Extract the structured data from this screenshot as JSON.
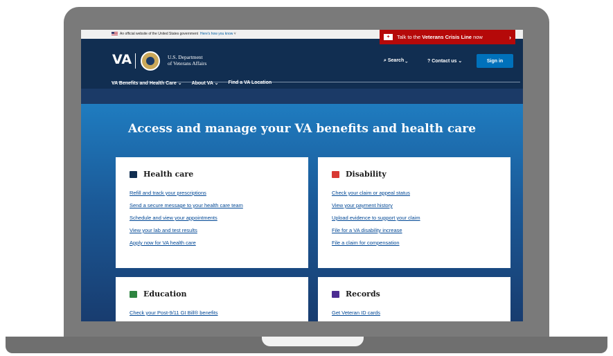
{
  "gov_banner": {
    "official_text": "An official website of the United States government",
    "how_text": "Here's how you know"
  },
  "crisis": {
    "icon": "crisis-line-icon",
    "prefix": "Talk to the",
    "bold": "Veterans Crisis Line",
    "suffix": "now",
    "chevron": "›"
  },
  "header": {
    "logo": "VA",
    "dept_line1": "U.S. Department",
    "dept_line2": "of Veterans Affairs",
    "search_label": "Search",
    "contact_label": "Contact us",
    "signin_label": "Sign in"
  },
  "nav": {
    "items": [
      "VA Benefits and Health Care",
      "About VA",
      "Find a VA Location"
    ]
  },
  "hero": {
    "title": "Access and manage your VA benefits and health care"
  },
  "cards": {
    "health": {
      "title": "Health care",
      "icon": "medkit-icon",
      "color": "#112e51",
      "links": [
        "Refill and track your prescriptions",
        "Send a secure message to your health care team",
        "Schedule and view your appointments",
        "View your lab and test results",
        "Apply now for VA health care"
      ]
    },
    "disability": {
      "title": "Disability",
      "icon": "disability-icon",
      "color": "#d83933",
      "links": [
        "Check your claim or appeal status",
        "View your payment history",
        "Upload evidence to support your claim",
        "File for a VA disability increase",
        "File a claim for compensation"
      ]
    },
    "education": {
      "title": "Education",
      "icon": "graduation-cap-icon",
      "color": "#2e8540",
      "links": [
        "Check your Post-9/11 GI Bill® benefits"
      ]
    },
    "records": {
      "title": "Records",
      "icon": "id-card-icon",
      "color": "#4c2c92",
      "links": [
        "Get Veteran ID cards"
      ]
    }
  },
  "colors": {
    "header_bg": "#112e51",
    "crisis_red": "#b50909",
    "signin_blue": "#0071bb",
    "link": "#004795"
  }
}
